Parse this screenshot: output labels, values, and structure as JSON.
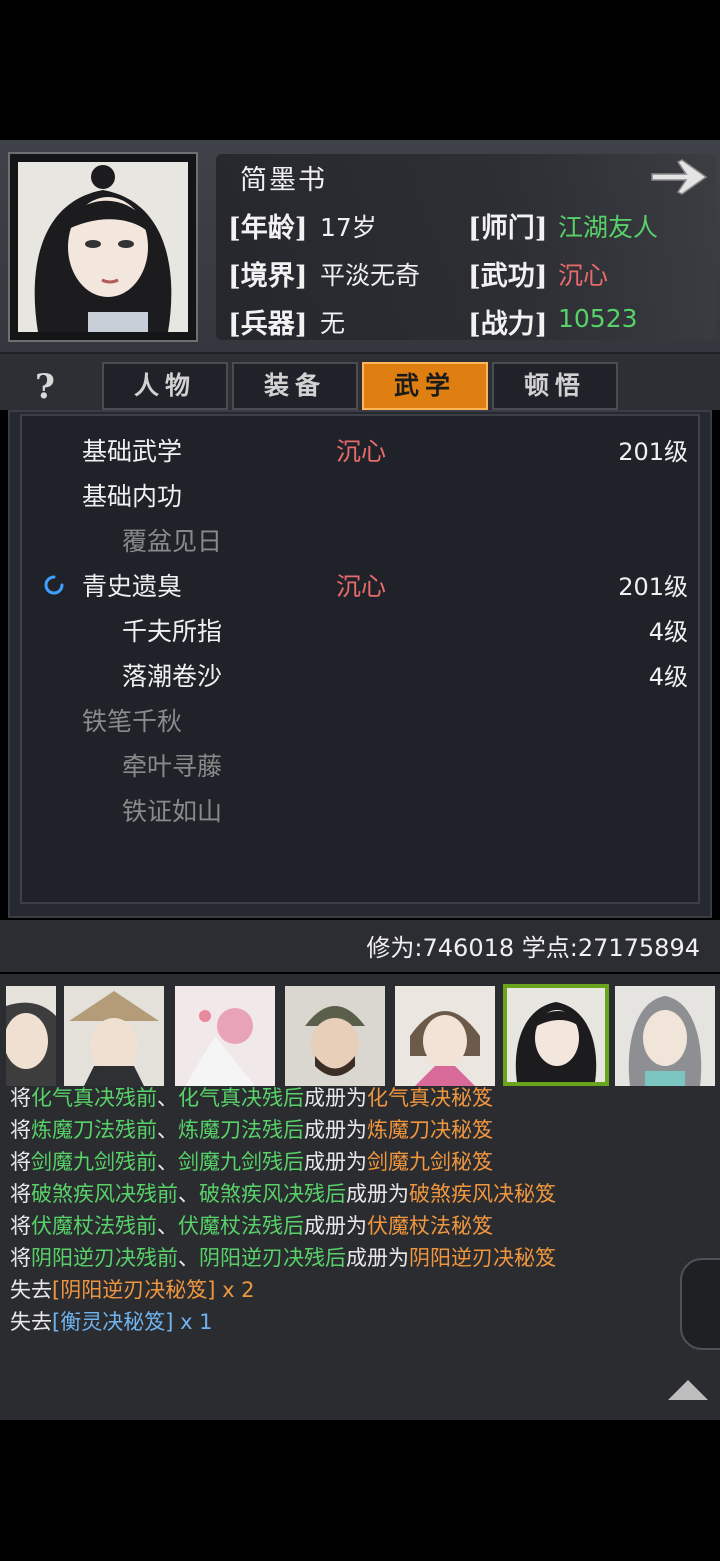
{
  "character": {
    "name": "简墨书",
    "stats": {
      "age_label": "[年龄]",
      "age": "17岁",
      "sect_label": "[师门]",
      "sect": "江湖友人",
      "realm_label": "[境界]",
      "realm": "平淡无奇",
      "martial_label": "[武功]",
      "martial": "沉心",
      "weapon_label": "[兵器]",
      "weapon": "无",
      "power_label": "[战力]",
      "power": "10523"
    }
  },
  "tabs": [
    {
      "label": "人物",
      "active": false
    },
    {
      "label": "装备",
      "active": false
    },
    {
      "label": "武学",
      "active": true
    },
    {
      "label": "顿悟",
      "active": false
    }
  ],
  "help_label": "?",
  "skills": [
    {
      "name": "基础武学",
      "tag": "沉心",
      "level": "201级",
      "indent": false,
      "dim": false
    },
    {
      "name": "基础内功",
      "tag": "",
      "level": "",
      "indent": false,
      "dim": false
    },
    {
      "name": "覆盆见日",
      "tag": "",
      "level": "",
      "indent": true,
      "dim": true
    },
    {
      "name": "青史遗臭",
      "tag": "沉心",
      "level": "201级",
      "indent": false,
      "dim": false,
      "active": true
    },
    {
      "name": "千夫所指",
      "tag": "",
      "level": "4级",
      "indent": true,
      "dim": false
    },
    {
      "name": "落潮卷沙",
      "tag": "",
      "level": "4级",
      "indent": true,
      "dim": false
    },
    {
      "name": "铁笔千秋",
      "tag": "",
      "level": "",
      "indent": false,
      "dim": true
    },
    {
      "name": "牵叶寻藤",
      "tag": "",
      "level": "",
      "indent": true,
      "dim": true
    },
    {
      "name": "铁证如山",
      "tag": "",
      "level": "",
      "indent": true,
      "dim": true
    }
  ],
  "points": "修为:746018  学点:27175894",
  "log": [
    [
      {
        "t": "将",
        "c": "w"
      },
      {
        "t": "化气真决残前",
        "c": "g"
      },
      {
        "t": "、",
        "c": "w"
      },
      {
        "t": "化气真决残后",
        "c": "g"
      },
      {
        "t": "成册为",
        "c": "w"
      },
      {
        "t": "化气真决秘笈",
        "c": "o"
      }
    ],
    [
      {
        "t": "将",
        "c": "w"
      },
      {
        "t": "炼魔刀法残前",
        "c": "g"
      },
      {
        "t": "、",
        "c": "w"
      },
      {
        "t": "炼魔刀法残后",
        "c": "g"
      },
      {
        "t": "成册为",
        "c": "w"
      },
      {
        "t": "炼魔刀决秘笈",
        "c": "o"
      }
    ],
    [
      {
        "t": "将",
        "c": "w"
      },
      {
        "t": "剑魔九剑残前",
        "c": "g"
      },
      {
        "t": "、",
        "c": "w"
      },
      {
        "t": "剑魔九剑残后",
        "c": "g"
      },
      {
        "t": "成册为",
        "c": "w"
      },
      {
        "t": "剑魔九剑秘笈",
        "c": "o"
      }
    ],
    [
      {
        "t": "将",
        "c": "w"
      },
      {
        "t": "破煞疾风决残前",
        "c": "g"
      },
      {
        "t": "、",
        "c": "w"
      },
      {
        "t": "破煞疾风决残后",
        "c": "g"
      },
      {
        "t": "成册为",
        "c": "w"
      },
      {
        "t": "破煞疾风决秘笈",
        "c": "o"
      }
    ],
    [
      {
        "t": "将",
        "c": "w"
      },
      {
        "t": "伏魔杖法残前",
        "c": "g"
      },
      {
        "t": "、",
        "c": "w"
      },
      {
        "t": "伏魔杖法残后",
        "c": "g"
      },
      {
        "t": "成册为",
        "c": "w"
      },
      {
        "t": "伏魔杖法秘笈",
        "c": "o"
      }
    ],
    [
      {
        "t": "将",
        "c": "w"
      },
      {
        "t": "阴阳逆刃决残前",
        "c": "g"
      },
      {
        "t": "、",
        "c": "w"
      },
      {
        "t": "阴阳逆刃决残后",
        "c": "g"
      },
      {
        "t": "成册为",
        "c": "w"
      },
      {
        "t": "阴阳逆刃决秘笈",
        "c": "o"
      }
    ],
    [
      {
        "t": "失去",
        "c": "w"
      },
      {
        "t": "[阴阳逆刃决秘笈]",
        "c": "o"
      },
      {
        "t": " x 2",
        "c": "o"
      }
    ],
    [
      {
        "t": "失去",
        "c": "w"
      },
      {
        "t": "[衡灵决秘笈]",
        "c": "b"
      },
      {
        "t": " x 1",
        "c": "b"
      }
    ]
  ],
  "colors": {
    "accent": "#df7f11",
    "selected_border": "#6aa31c",
    "realm_green": "#58d268",
    "martial_red": "#e86b6b"
  }
}
